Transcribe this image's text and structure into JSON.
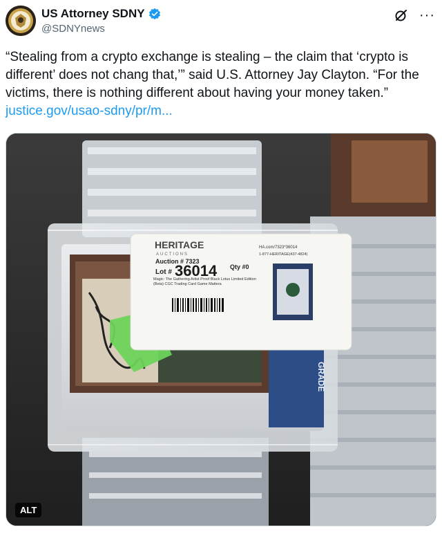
{
  "author": {
    "display_name": "US Attorney SDNY",
    "handle": "@SDNYnews",
    "verified": true,
    "avatar_icon": "doj-seal-icon"
  },
  "actions": {
    "grok_icon": "grok-icon",
    "more_label": "···"
  },
  "tweet": {
    "text": "“Stealing from a crypto exchange is stealing – the claim that ‘crypto is different’ does not chang that,’” said U.S. Attorney Jay Clayton. “For the victims, there is nothing different about having your money taken.”",
    "link": "justice.gov/usao-sdny/pr/m..."
  },
  "media": {
    "alt_badge": "ALT",
    "label": {
      "brand": "HERITAGE",
      "brand_sub": "AUCTIONS",
      "auction": "Auction # 7323",
      "lot_prefix": "Lot #",
      "lot_number": "36014",
      "qty": "Qty #0",
      "url_line1": "HA.com/7323*36014",
      "url_line2": "1-877-HERITAGE(437-4824)",
      "desc": "Magic: The Gathering Artist Proof Black Lotus Limited Edition (Beta) CGC Trading Card Game Mattera",
      "grade_text": "GRADE"
    }
  },
  "colors": {
    "link": "#1d9bf0",
    "verified": "#1d9bf0",
    "muted": "#536471",
    "sticker": "#6dd35a"
  }
}
